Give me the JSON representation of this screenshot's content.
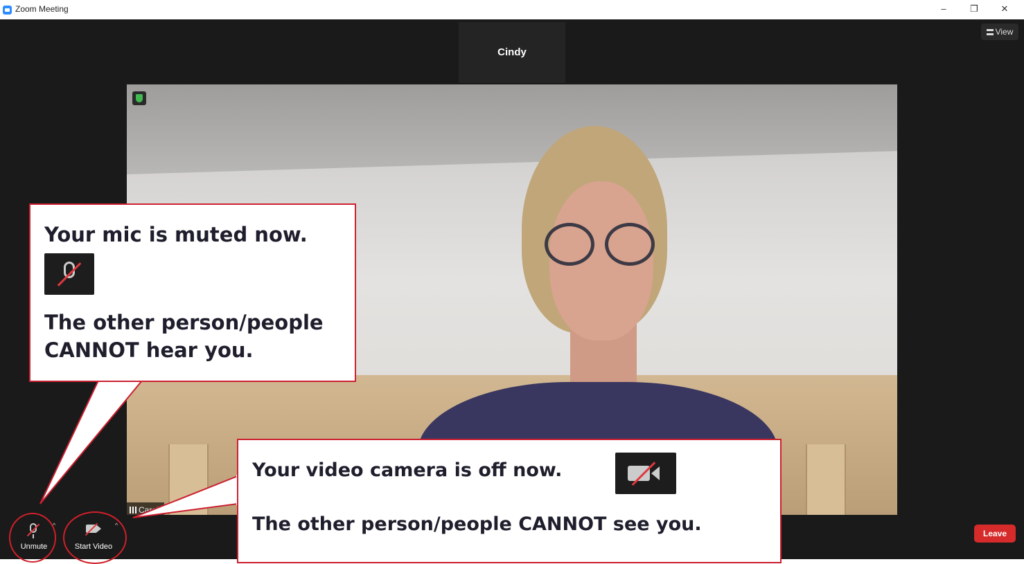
{
  "window": {
    "title": "Zoom Meeting",
    "controls": {
      "minimize": "–",
      "restore": "❐",
      "close": "✕"
    }
  },
  "top_right": {
    "view_label": "View"
  },
  "thumbnail": {
    "participant_name": "Cindy"
  },
  "main_video": {
    "name_tag": "Caroli",
    "signal_icon": "signal-bars-icon",
    "security_icon": "shield-check-icon"
  },
  "toolbar": {
    "unmute_label": "Unmute",
    "start_video_label": "Start Video",
    "caret": "^",
    "leave_label": "Leave",
    "leave_color": "#d52b2b"
  },
  "callouts": {
    "mic": {
      "line1": "Your mic is muted now.",
      "line2": "The other person/people CANNOT hear you.",
      "icon": "muted-mic-icon"
    },
    "video": {
      "line1": "Your video camera is off now.",
      "line2": "The other person/people CANNOT see you.",
      "icon": "video-off-icon"
    },
    "border_color": "#cc2030"
  }
}
